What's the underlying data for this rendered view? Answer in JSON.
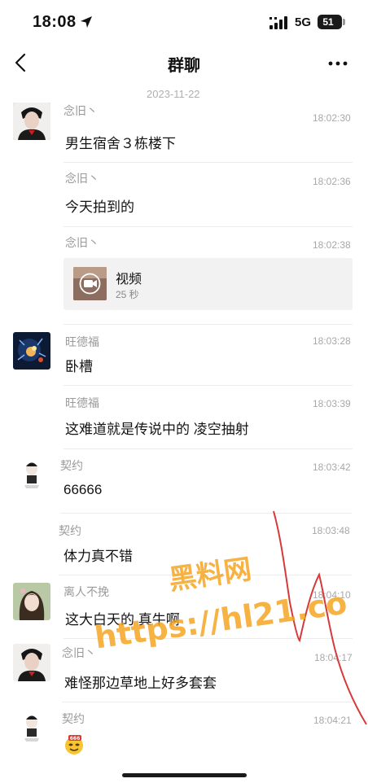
{
  "status_bar": {
    "time": "18:08",
    "network": "5G",
    "battery": "51"
  },
  "header": {
    "title": "群聊"
  },
  "date_separator": "2023-11-22",
  "messages": [
    {
      "sender": "念旧丶",
      "time": "18:02:30",
      "text": "男生宿舍３栋楼下"
    },
    {
      "sender": "念旧丶",
      "time": "18:02:36",
      "text": "今天拍到的"
    },
    {
      "sender": "念旧丶",
      "time": "18:02:38",
      "video": {
        "label": "视频",
        "duration": "25 秒"
      }
    },
    {
      "sender": "旺德福",
      "time": "18:03:28",
      "text": "卧槽"
    },
    {
      "sender": "旺德福",
      "time": "18:03:39",
      "text": "这难道就是传说中的 凌空抽射"
    },
    {
      "sender": "契约",
      "time": "18:03:42",
      "text": "66666"
    },
    {
      "sender": "契约",
      "time": "18:03:48",
      "text": "体力真不错"
    },
    {
      "sender": "离人不挽",
      "time": "18:04:10",
      "text": "这大白天的 真牛啊"
    },
    {
      "sender": "念旧丶",
      "time": "18:04:17",
      "text": "难怪那边草地上好多套套"
    },
    {
      "sender": "契约",
      "time": "18:04:21",
      "sticker": "666-emoji"
    }
  ],
  "watermark": {
    "line1": "黑料网",
    "line2": "https://hl21.co"
  },
  "colors": {
    "watermark": "#f5a21a",
    "scribble": "#d63a3a",
    "divider": "#ececec"
  }
}
